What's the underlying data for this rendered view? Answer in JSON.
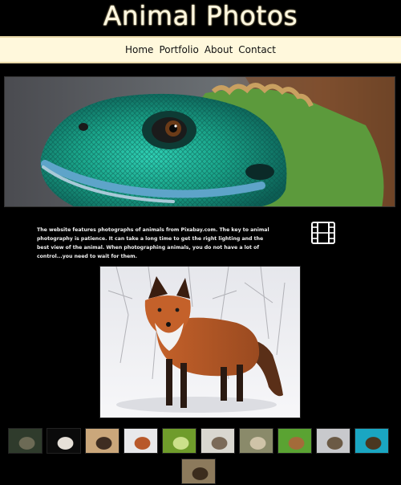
{
  "site": {
    "title": "Animal Photos"
  },
  "nav": {
    "items": [
      "Home",
      "Portfolio",
      "About",
      "Contact"
    ]
  },
  "hero": {
    "alt": "Green water dragon lizard"
  },
  "intro": {
    "text": "The website features photographs of animals from Pixabay.com. The key to animal photography is patience. It can take a long time to get the right lighting and the best view of the animal. When photographing animals, you do not have a lot of control...you need to wait for them."
  },
  "icons": {
    "film": "film-icon"
  },
  "feature": {
    "alt": "Red fox standing in snow"
  },
  "gallery": {
    "thumbs": [
      {
        "name": "thumb-deer",
        "colors": [
          "#2f3b2c",
          "#6c6a55"
        ]
      },
      {
        "name": "thumb-eagle",
        "colors": [
          "#0b0b0b",
          "#e6e0d8"
        ]
      },
      {
        "name": "thumb-bison",
        "colors": [
          "#caa77b",
          "#3e2d21"
        ]
      },
      {
        "name": "thumb-fox",
        "colors": [
          "#e8e8ea",
          "#b8582a"
        ]
      },
      {
        "name": "thumb-chameleon",
        "colors": [
          "#6f9c2b",
          "#cbe08a"
        ]
      },
      {
        "name": "thumb-hedgehog",
        "colors": [
          "#d9d7d0",
          "#7b6a58"
        ]
      },
      {
        "name": "thumb-hamster",
        "colors": [
          "#8a8a6a",
          "#cfc3a8"
        ]
      },
      {
        "name": "thumb-squirrel",
        "colors": [
          "#5aa332",
          "#a36b3a"
        ]
      },
      {
        "name": "thumb-ram",
        "colors": [
          "#c8c9cc",
          "#6b5a45"
        ]
      },
      {
        "name": "thumb-turtle",
        "colors": [
          "#1aa6c2",
          "#4a3720"
        ]
      },
      {
        "name": "thumb-otter",
        "colors": [
          "#8c7a5c",
          "#3b2c1d"
        ]
      }
    ]
  }
}
